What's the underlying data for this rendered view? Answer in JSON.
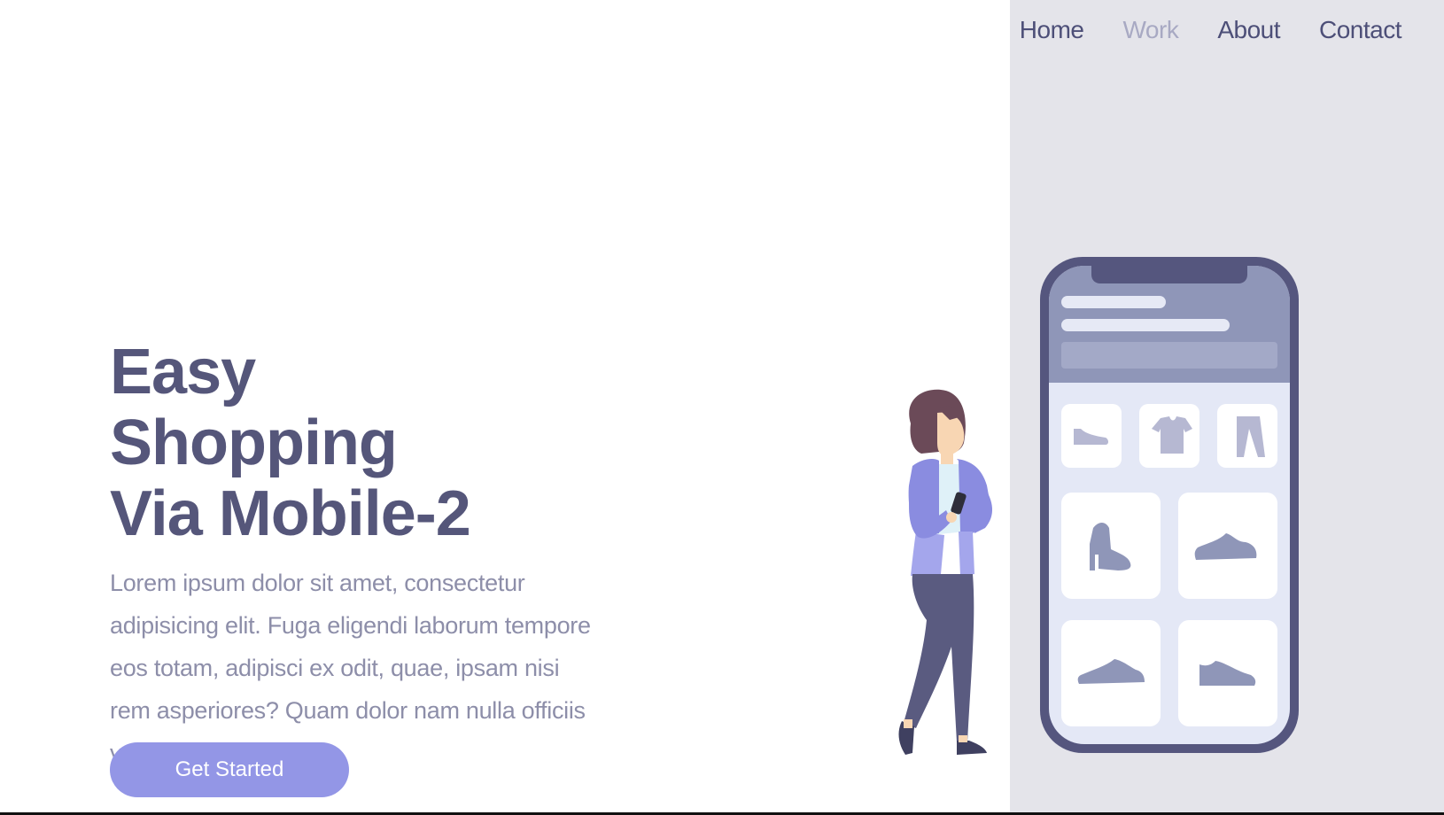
{
  "nav": {
    "items": [
      {
        "label": "Home",
        "active": false
      },
      {
        "label": "Work",
        "active": true
      },
      {
        "label": "About",
        "active": false
      },
      {
        "label": "Contact",
        "active": false
      }
    ]
  },
  "hero": {
    "title_lines": [
      "Easy",
      "Shopping",
      "Via Mobile-2"
    ],
    "description": "Lorem ipsum dolor sit amet, consectetur adipisicing elit. Fuga eligendi laborum tempore eos totam, adipisci ex odit, quae, ipsam nisi rem asperiores? Quam dolor nam nulla officiis vero nihil similique.",
    "cta_label": "Get Started"
  },
  "illustration": {
    "phone_categories": [
      "shoe-icon",
      "tshirt-icon",
      "pants-icon"
    ],
    "phone_products": [
      "boot-icon",
      "sneaker-icon",
      "sneaker-icon",
      "sneaker-icon"
    ]
  },
  "colors": {
    "title": "#55567a",
    "body_text": "#8d8ea9",
    "nav_text": "#4d4f78",
    "nav_active": "#a8a9c3",
    "cta_bg": "#9396e6",
    "panel_bg": "#e4e4ea",
    "phone_frame": "#55567e"
  }
}
